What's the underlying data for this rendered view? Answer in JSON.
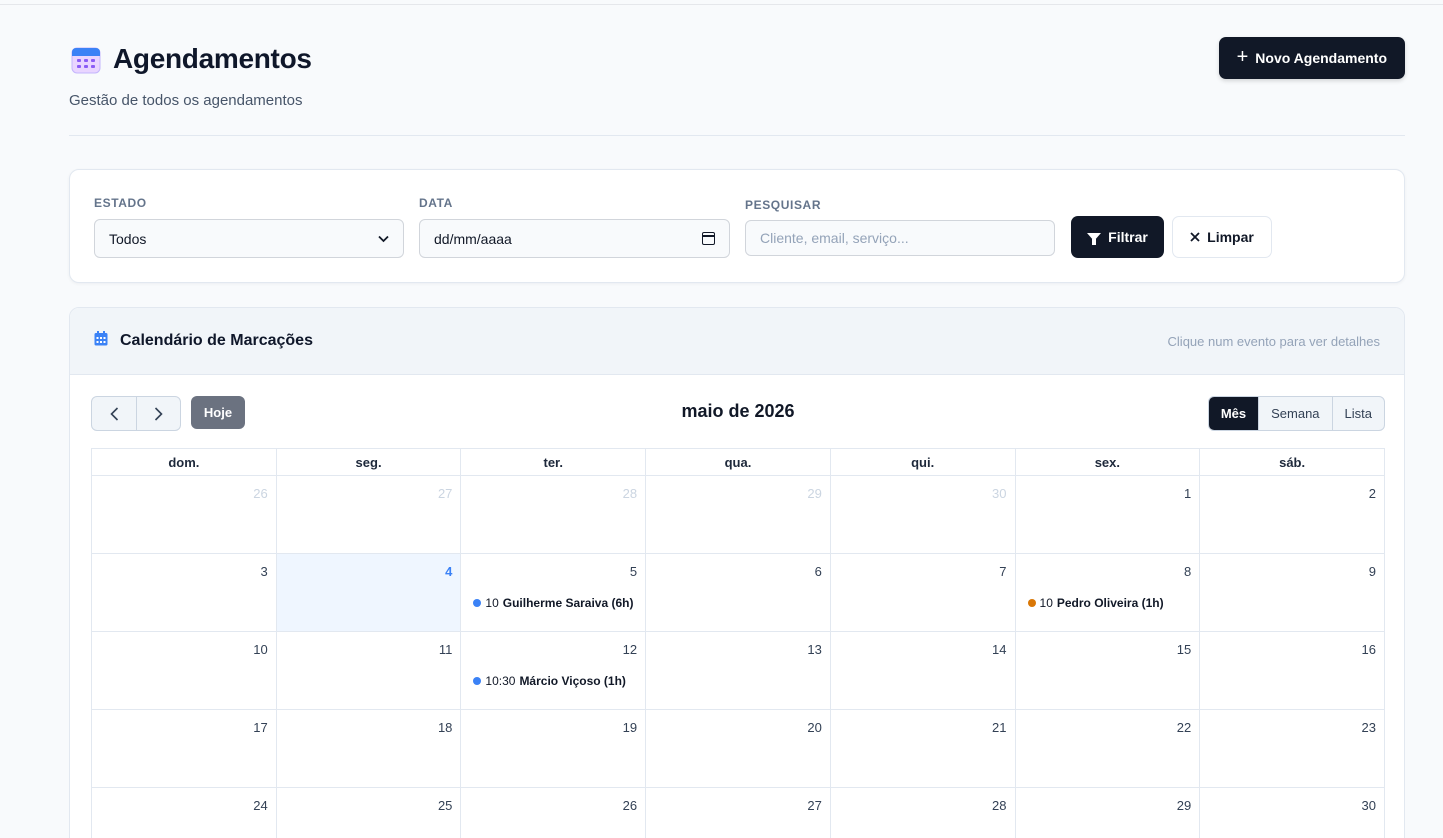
{
  "header": {
    "title": "Agendamentos",
    "subtitle": "Gestão de todos os agendamentos",
    "new_button": "Novo Agendamento"
  },
  "filters": {
    "status_label": "ESTADO",
    "status_value": "Todos",
    "date_label": "DATA",
    "date_value": "dd/mm/aaaa",
    "search_label": "PESQUISAR",
    "search_placeholder": "Cliente, email, serviço...",
    "filter_button": "Filtrar",
    "clear_button": "Limpar"
  },
  "calendar": {
    "title": "Calendário de Marcações",
    "hint": "Clique num evento para ver detalhes",
    "today_button": "Hoje",
    "month_title": "maio de 2026",
    "views": [
      "Mês",
      "Semana",
      "Lista"
    ],
    "active_view": "Mês",
    "weekdays": [
      "dom.",
      "seg.",
      "ter.",
      "qua.",
      "qui.",
      "sex.",
      "sáb."
    ],
    "weeks": [
      [
        {
          "d": "26",
          "other": true
        },
        {
          "d": "27",
          "other": true
        },
        {
          "d": "28",
          "other": true
        },
        {
          "d": "29",
          "other": true
        },
        {
          "d": "30",
          "other": true
        },
        {
          "d": "1"
        },
        {
          "d": "2"
        }
      ],
      [
        {
          "d": "3"
        },
        {
          "d": "4",
          "today": true
        },
        {
          "d": "5",
          "event": {
            "time": "10",
            "title": "Guilherme Saraiva (6h)",
            "color": "#3b82f6"
          }
        },
        {
          "d": "6"
        },
        {
          "d": "7"
        },
        {
          "d": "8",
          "event": {
            "time": "10",
            "title": "Pedro Oliveira (1h)",
            "color": "#d97706"
          }
        },
        {
          "d": "9"
        }
      ],
      [
        {
          "d": "10"
        },
        {
          "d": "11"
        },
        {
          "d": "12",
          "event": {
            "time": "10:30",
            "title": "Márcio Viçoso (1h)",
            "color": "#3b82f6"
          }
        },
        {
          "d": "13"
        },
        {
          "d": "14"
        },
        {
          "d": "15"
        },
        {
          "d": "16"
        }
      ],
      [
        {
          "d": "17"
        },
        {
          "d": "18"
        },
        {
          "d": "19"
        },
        {
          "d": "20"
        },
        {
          "d": "21"
        },
        {
          "d": "22"
        },
        {
          "d": "23"
        }
      ],
      [
        {
          "d": "24"
        },
        {
          "d": "25"
        },
        {
          "d": "26"
        },
        {
          "d": "27"
        },
        {
          "d": "28"
        },
        {
          "d": "29"
        },
        {
          "d": "30"
        }
      ]
    ]
  }
}
